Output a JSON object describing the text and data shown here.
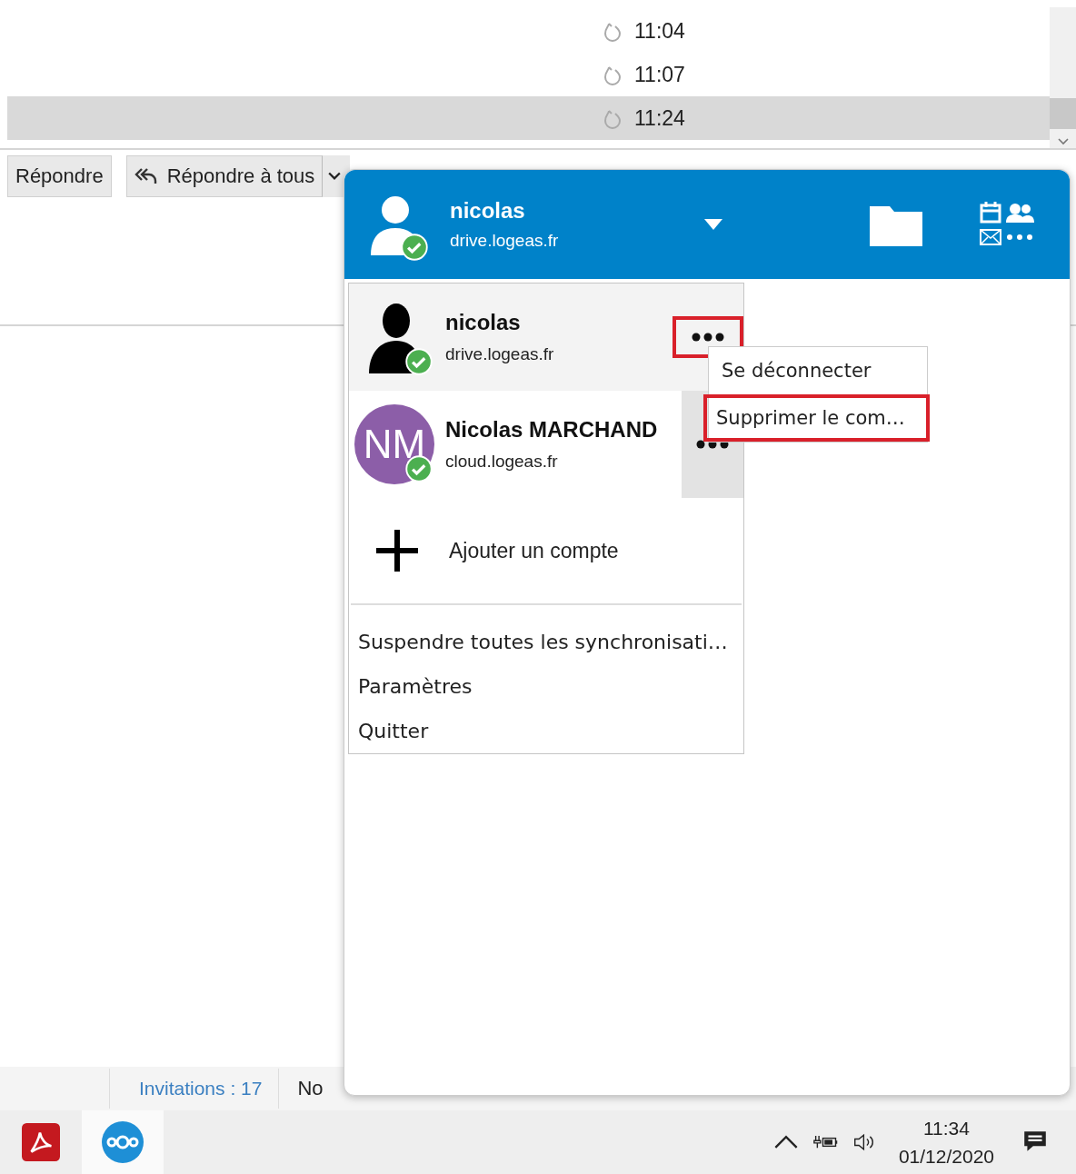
{
  "mail_list": {
    "rows": [
      {
        "time": "11:04",
        "selected": false
      },
      {
        "time": "11:07",
        "selected": false
      },
      {
        "time": "11:24",
        "selected": true
      }
    ]
  },
  "toolbar": {
    "buttons": [
      {
        "label": "Répondre",
        "kind": "plain"
      },
      {
        "label": "Répondre à tous",
        "kind": "reply-all"
      }
    ]
  },
  "status_bar": {
    "invitations": "Invitations : 17",
    "column_2": "No"
  },
  "popup": {
    "header": {
      "name": "nicolas",
      "server": "drive.logeas.fr",
      "connected": true
    },
    "accounts": [
      {
        "name": "nicolas",
        "server": "drive.logeas.fr",
        "kind": "silhouette",
        "connected": true,
        "selected": true,
        "hovered": false,
        "annotated": true
      },
      {
        "name": "Nicolas MARCHAND",
        "server": "cloud.logeas.fr",
        "kind": "initials",
        "initials": "NM",
        "connected": true,
        "selected": false,
        "hovered": true,
        "annotated": false
      }
    ],
    "add_account": "Ajouter un compte",
    "menu_items": [
      {
        "label": "Suspendre toutes les synchronisati…"
      },
      {
        "label": "Paramètres"
      },
      {
        "label": "Quitter"
      }
    ],
    "context_menu": [
      {
        "label": "Se déconnecter",
        "annotated": false
      },
      {
        "label": "Supprimer le com…",
        "annotated": true
      }
    ]
  },
  "taskbar": {
    "apps": [
      {
        "kind": "pdf",
        "selected": false
      },
      {
        "kind": "nextcloud",
        "selected": true
      }
    ],
    "time": "11:34",
    "date": "01/12/2020"
  }
}
